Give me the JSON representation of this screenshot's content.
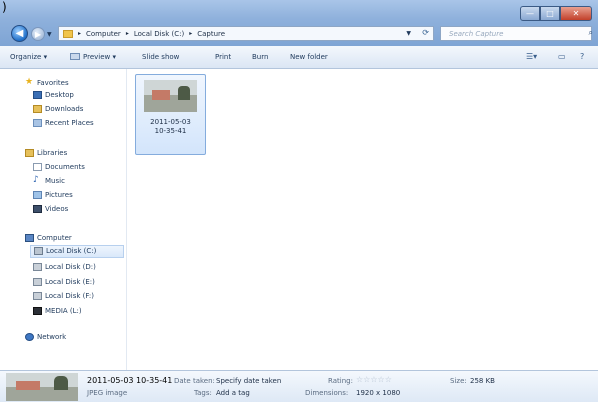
{
  "window": {
    "corner_glyph": ")",
    "controls": {
      "minimize": "—",
      "maximize": "□",
      "close": "✕"
    }
  },
  "address_bar": {
    "crumbs": [
      "Computer",
      "Local Disk (C:)",
      "Capture"
    ],
    "separator": "▸"
  },
  "search": {
    "placeholder": "Search Capture"
  },
  "toolbar": {
    "organize": "Organize ▾",
    "preview": "Preview ▾",
    "slideshow": "Slide show",
    "print": "Print",
    "burn": "Burn",
    "new_folder": "New folder"
  },
  "nav": {
    "favorites": "Favorites",
    "desktop": "Desktop",
    "downloads": "Downloads",
    "recent": "Recent Places",
    "libraries": "Libraries",
    "documents": "Documents",
    "music": "Music",
    "pictures": "Pictures",
    "videos": "Videos",
    "computer": "Computer",
    "disk_c": "Local Disk (C:)",
    "disk_d": "Local Disk (D:)",
    "disk_e": "Local Disk (E:)",
    "disk_f": "Local Disk (F:)",
    "media": "MEDIA (L:)",
    "network": "Network"
  },
  "files": [
    {
      "name_line1": "2011-05-03",
      "name_line2": "10-35-41"
    }
  ],
  "details": {
    "filename": "2011-05-03 10-35-41",
    "filetype": "JPEG image",
    "date_taken_label": "Date taken:",
    "date_taken_value": "Specify date taken",
    "tags_label": "Tags:",
    "tags_value": "Add a tag",
    "rating_label": "Rating:",
    "rating_stars": 0,
    "dimensions_label": "Dimensions:",
    "dimensions_value": "1920 x 1080",
    "size_label": "Size:",
    "size_value": "258 KB"
  },
  "colors": {
    "title_gradient_top": "#a9c5e8",
    "title_gradient_bottom": "#7ea4d4",
    "selection_border": "#84acdd",
    "text": "#1e395b"
  },
  "icons": [
    "back-icon",
    "forward-icon",
    "folder-icon",
    "refresh-icon",
    "search-icon",
    "star-icon",
    "computer-icon",
    "disk-icon",
    "network-icon"
  ]
}
